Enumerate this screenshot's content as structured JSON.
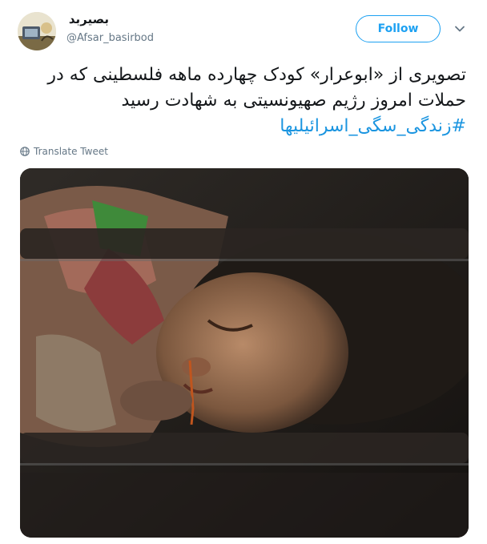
{
  "tweet": {
    "display_name": "بصیربد",
    "handle": "@Afsar_basirbod",
    "follow_label": "Follow",
    "text_lines": [
      "تصویری از «ابوعرار» کودک چهارده ماهه فلسطینی که در",
      "حملات امروز رژیم صهیونسیتی به شهادت رسید"
    ],
    "hashtag": "#زندگی_سگی_اسرائیلیها",
    "translate_label": "Translate Tweet"
  },
  "icons": {
    "chevron": "chevron-down-icon",
    "globe": "globe-icon"
  },
  "colors": {
    "accent": "#1da1f2",
    "hashtag": "#1b95e0",
    "muted": "#657786"
  }
}
